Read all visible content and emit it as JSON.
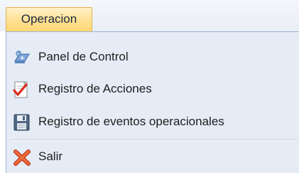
{
  "menubar": {
    "active_menu_label": "Operacion"
  },
  "menu": {
    "items": [
      {
        "label": "Panel de Control",
        "icon": "control-panel-icon"
      },
      {
        "label": "Registro de Acciones",
        "icon": "checklist-icon"
      },
      {
        "label": "Registro de eventos operacionales",
        "icon": "floppy-disk-icon"
      },
      {
        "label": "Salir",
        "icon": "close-x-icon"
      }
    ]
  },
  "colors": {
    "active_tab": "#ffe092",
    "active_tab_border": "#e4b050",
    "dropdown_background": "#e6ecf6",
    "separator": "#c3cedd",
    "exit_icon": "#e0562b"
  }
}
